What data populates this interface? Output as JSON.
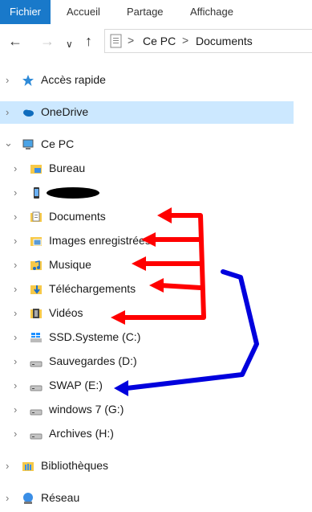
{
  "ribbon": {
    "tabs": [
      "Fichier",
      "Accueil",
      "Partage",
      "Affichage"
    ]
  },
  "address": {
    "segments": [
      "Ce PC",
      "Documents"
    ],
    "separator": ">"
  },
  "tree": {
    "quick_access": "Accès rapide",
    "onedrive": "OneDrive",
    "this_pc": "Ce PC",
    "items": [
      {
        "label": "Bureau",
        "icon": "desktop-folder-icon"
      },
      {
        "label": "",
        "icon": "phone-device-icon"
      },
      {
        "label": "Documents",
        "icon": "documents-folder-icon"
      },
      {
        "label": "Images enregistrées",
        "icon": "pictures-folder-icon"
      },
      {
        "label": "Musique",
        "icon": "music-folder-icon"
      },
      {
        "label": "Téléchargements",
        "icon": "downloads-folder-icon"
      },
      {
        "label": "Vidéos",
        "icon": "videos-folder-icon"
      },
      {
        "label": "SSD.Systeme (C:)",
        "icon": "windows-drive-icon"
      },
      {
        "label": "Sauvegardes (D:)",
        "icon": "drive-icon"
      },
      {
        "label": "SWAP (E:)",
        "icon": "drive-icon"
      },
      {
        "label": "windows 7 (G:)",
        "icon": "drive-icon"
      },
      {
        "label": "Archives (H:)",
        "icon": "drive-icon"
      }
    ],
    "libraries": "Bibliothèques",
    "network": "Réseau"
  },
  "colors": {
    "accent": "#1979ca",
    "selection": "#cce8ff",
    "annotation_red": "#ff0000",
    "annotation_blue": "#0000dd"
  }
}
